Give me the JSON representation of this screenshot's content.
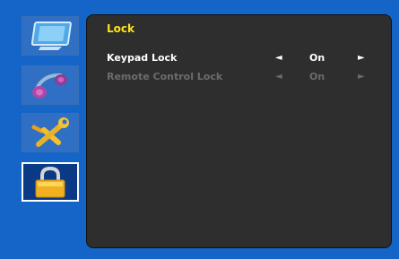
{
  "sidebar": {
    "items": [
      {
        "icon": "monitor-icon",
        "selected": false
      },
      {
        "icon": "audio-icon",
        "selected": false
      },
      {
        "icon": "tools-icon",
        "selected": false
      },
      {
        "icon": "lock-icon",
        "selected": true
      }
    ]
  },
  "panel": {
    "title": "Lock",
    "rows": [
      {
        "label": "Keypad Lock",
        "value": "On",
        "enabled": true,
        "left_arrow": "◄",
        "right_arrow": "►"
      },
      {
        "label": "Remote Control Lock",
        "value": "On",
        "enabled": false,
        "left_arrow": "◄",
        "right_arrow": "►"
      }
    ]
  },
  "colors": {
    "background": "#1565c8",
    "panel": "#2e2e2e",
    "title": "#ffe21a",
    "text": "#ffffff",
    "disabled_text": "#6c6c6c"
  }
}
